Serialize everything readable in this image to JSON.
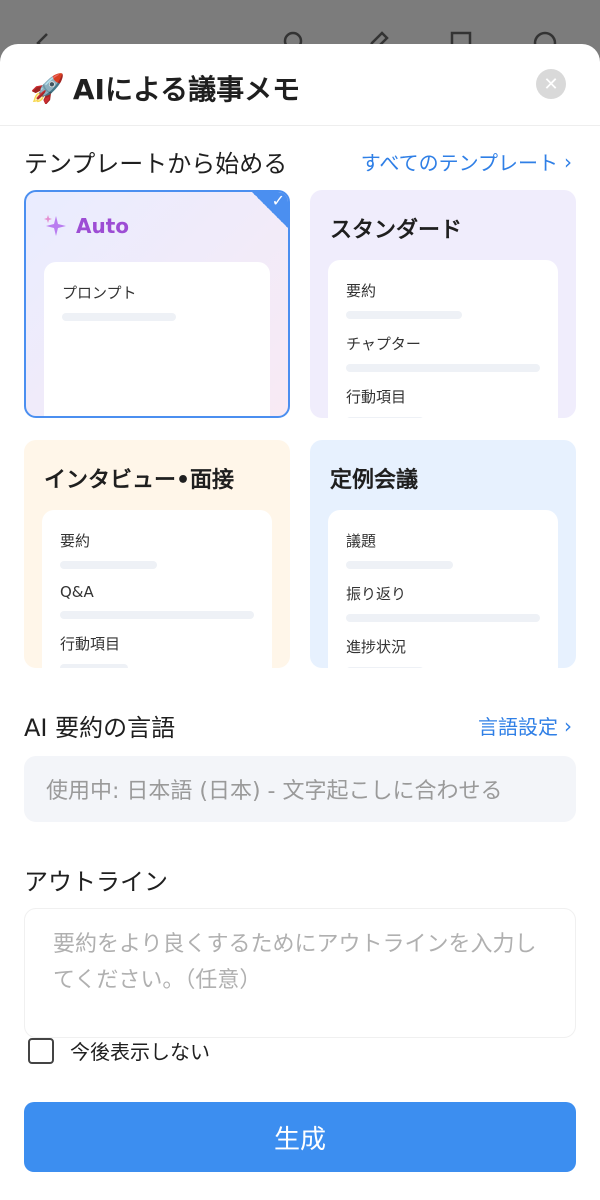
{
  "header": {
    "title": "AIによる議事メモ",
    "rocket_icon": "rocket-icon",
    "close_icon": "close-icon"
  },
  "templates": {
    "section_title": "テンプレートから始める",
    "all_link": "すべてのテンプレート",
    "cards": [
      {
        "title": "Auto",
        "selected": true,
        "lines": [
          "プロンプト"
        ]
      },
      {
        "title": "スタンダード",
        "selected": false,
        "lines": [
          "要約",
          "チャプター",
          "行動項目"
        ]
      },
      {
        "title": "インタビュー•面接",
        "selected": false,
        "lines": [
          "要約",
          "Q&A",
          "行動項目"
        ]
      },
      {
        "title": "定例会議",
        "selected": false,
        "lines": [
          "議題",
          "振り返り",
          "進捗状況"
        ]
      }
    ]
  },
  "language": {
    "section_title": "AI 要約の言語",
    "settings_link": "言語設定",
    "current": "使用中: 日本語 (日本) - 文字起こしに合わせる"
  },
  "outline": {
    "section_title": "アウトライン",
    "placeholder": "要約をより良くするためにアウトラインを入力してください。（任意）"
  },
  "dont_show_again": "今後表示しない",
  "generate_button": "生成",
  "colors": {
    "accent": "#3c8ef0",
    "link": "#2f7fe6",
    "auto_text": "#9d4dd4"
  }
}
